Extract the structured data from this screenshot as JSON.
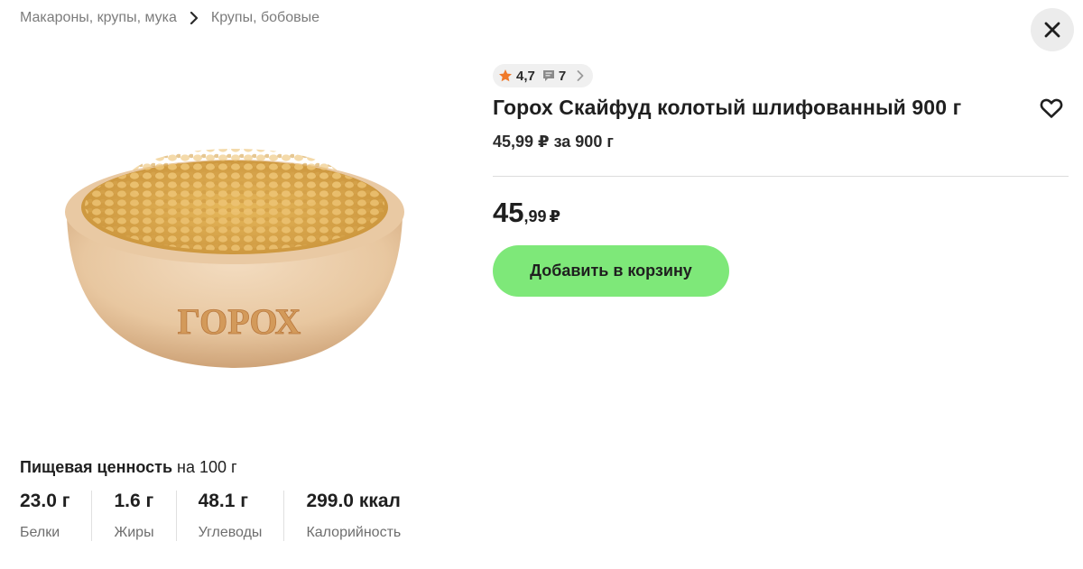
{
  "breadcrumb": {
    "items": [
      "Макароны, крупы, мука",
      "Крупы, бобовые"
    ]
  },
  "product": {
    "image_alt": "ГОРОХ",
    "rating": "4,7",
    "reviews_count": "7",
    "title": "Горох Скайфуд колотый шлифованный 900 г",
    "unit_price": "45,99 ₽ за 900 г",
    "price_int": "45",
    "price_cents": ",99",
    "currency": "₽",
    "add_to_cart_label": "Добавить в корзину"
  },
  "nutrition": {
    "title_bold": "Пищевая ценность",
    "title_rest": " на 100 г",
    "items": [
      {
        "value": "23.0 г",
        "label": "Белки"
      },
      {
        "value": "1.6 г",
        "label": "Жиры"
      },
      {
        "value": "48.1 г",
        "label": "Углеводы"
      },
      {
        "value": "299.0 ккал",
        "label": "Калорийность"
      }
    ]
  },
  "colors": {
    "accent_button": "#7ee879",
    "star": "#f07a2b"
  },
  "icons": {
    "breadcrumb_separator": "chevron-right-icon",
    "close": "close-icon",
    "star": "star-icon",
    "comment": "comment-icon",
    "rating_chevron": "chevron-right-icon",
    "favorite": "heart-icon"
  }
}
